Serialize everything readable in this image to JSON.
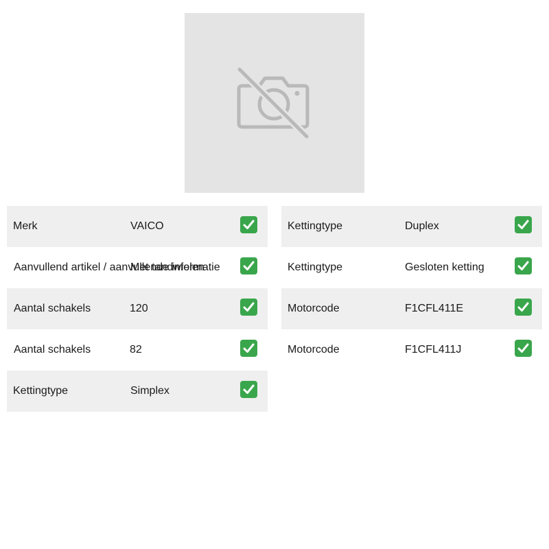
{
  "image": {
    "icon": "camera-off-icon",
    "background": "#e4e4e4"
  },
  "colors": {
    "row_shade": "#efefef",
    "check_green": "#3aa64c"
  },
  "left_specs": [
    {
      "label": "Merk",
      "value": "VAICO",
      "icon": "check-icon"
    },
    {
      "label": "Aanvullend artikel / aanvullende informatie",
      "value": "Met tandwielen",
      "icon": "check-icon"
    },
    {
      "label": "Aantal schakels",
      "value": "120",
      "icon": "check-icon"
    },
    {
      "label": "Aantal schakels",
      "value": "82",
      "icon": "check-icon"
    },
    {
      "label": "Kettingtype",
      "value": "Simplex",
      "icon": "check-icon"
    }
  ],
  "right_specs": [
    {
      "label": "Kettingtype",
      "value": "Duplex",
      "icon": "check-icon"
    },
    {
      "label": "Kettingtype",
      "value": "Gesloten ketting",
      "icon": "check-icon"
    },
    {
      "label": "Motorcode",
      "value": "F1CFL411E",
      "icon": "check-icon"
    },
    {
      "label": "Motorcode",
      "value": "F1CFL411J",
      "icon": "check-icon"
    }
  ]
}
